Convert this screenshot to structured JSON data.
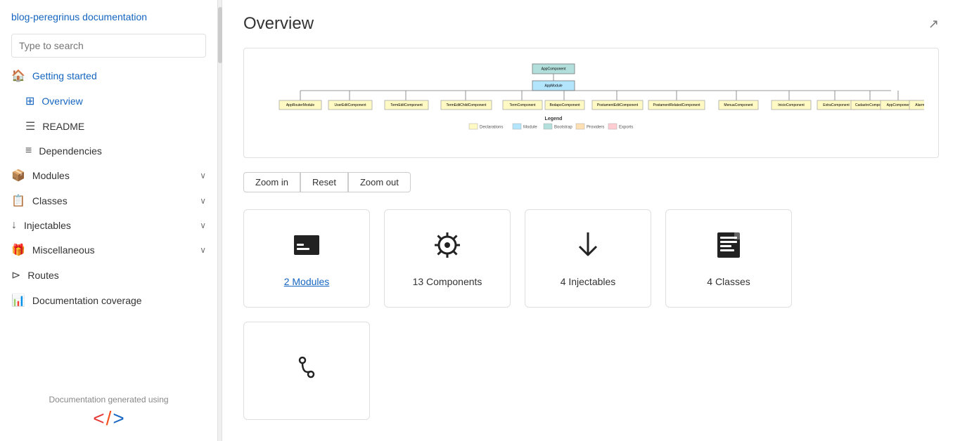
{
  "sidebar": {
    "title": "blog-peregrinus documentation",
    "search_placeholder": "Type to search",
    "items": [
      {
        "id": "getting-started",
        "label": "Getting started",
        "icon": "🏠",
        "type": "section"
      },
      {
        "id": "overview",
        "label": "Overview",
        "icon": "⊞",
        "type": "sub",
        "active": true
      },
      {
        "id": "readme",
        "label": "README",
        "icon": "☰",
        "type": "sub"
      },
      {
        "id": "dependencies",
        "label": "Dependencies",
        "icon": "≡",
        "type": "sub"
      },
      {
        "id": "modules",
        "label": "Modules",
        "icon": "📦",
        "type": "section",
        "expandable": true
      },
      {
        "id": "classes",
        "label": "Classes",
        "icon": "📋",
        "type": "section",
        "expandable": true
      },
      {
        "id": "injectables",
        "label": "Injectables",
        "icon": "↓",
        "type": "section",
        "expandable": true
      },
      {
        "id": "miscellaneous",
        "label": "Miscellaneous",
        "icon": "🎁",
        "type": "section",
        "expandable": true
      },
      {
        "id": "routes",
        "label": "Routes",
        "icon": "⊳",
        "type": "section"
      },
      {
        "id": "documentation-coverage",
        "label": "Documentation coverage",
        "icon": "📊",
        "type": "section"
      }
    ],
    "footer_text": "Documentation generated using"
  },
  "main": {
    "title": "Overview",
    "zoom_in": "Zoom in",
    "reset": "Reset",
    "zoom_out": "Zoom out",
    "cards": [
      {
        "id": "modules-card",
        "icon": "modules",
        "label": "2 Modules",
        "link": true
      },
      {
        "id": "components-card",
        "icon": "components",
        "label": "13 Components",
        "link": false
      },
      {
        "id": "injectables-card",
        "icon": "injectables",
        "label": "4 Injectables",
        "link": false
      },
      {
        "id": "classes-card",
        "icon": "classes",
        "label": "4 Classes",
        "link": false
      },
      {
        "id": "routes-card",
        "icon": "routes",
        "label": "",
        "link": false
      }
    ],
    "diagram": {
      "legend": [
        {
          "label": "Declarations",
          "color": "#fff9c4"
        },
        {
          "label": "Module",
          "color": "#b3e5fc"
        },
        {
          "label": "Bootstrap",
          "color": "#b2dfdb"
        },
        {
          "label": "Providers",
          "color": "#ffe0b2"
        },
        {
          "label": "Exports",
          "color": "#ffcdd2"
        }
      ]
    }
  }
}
